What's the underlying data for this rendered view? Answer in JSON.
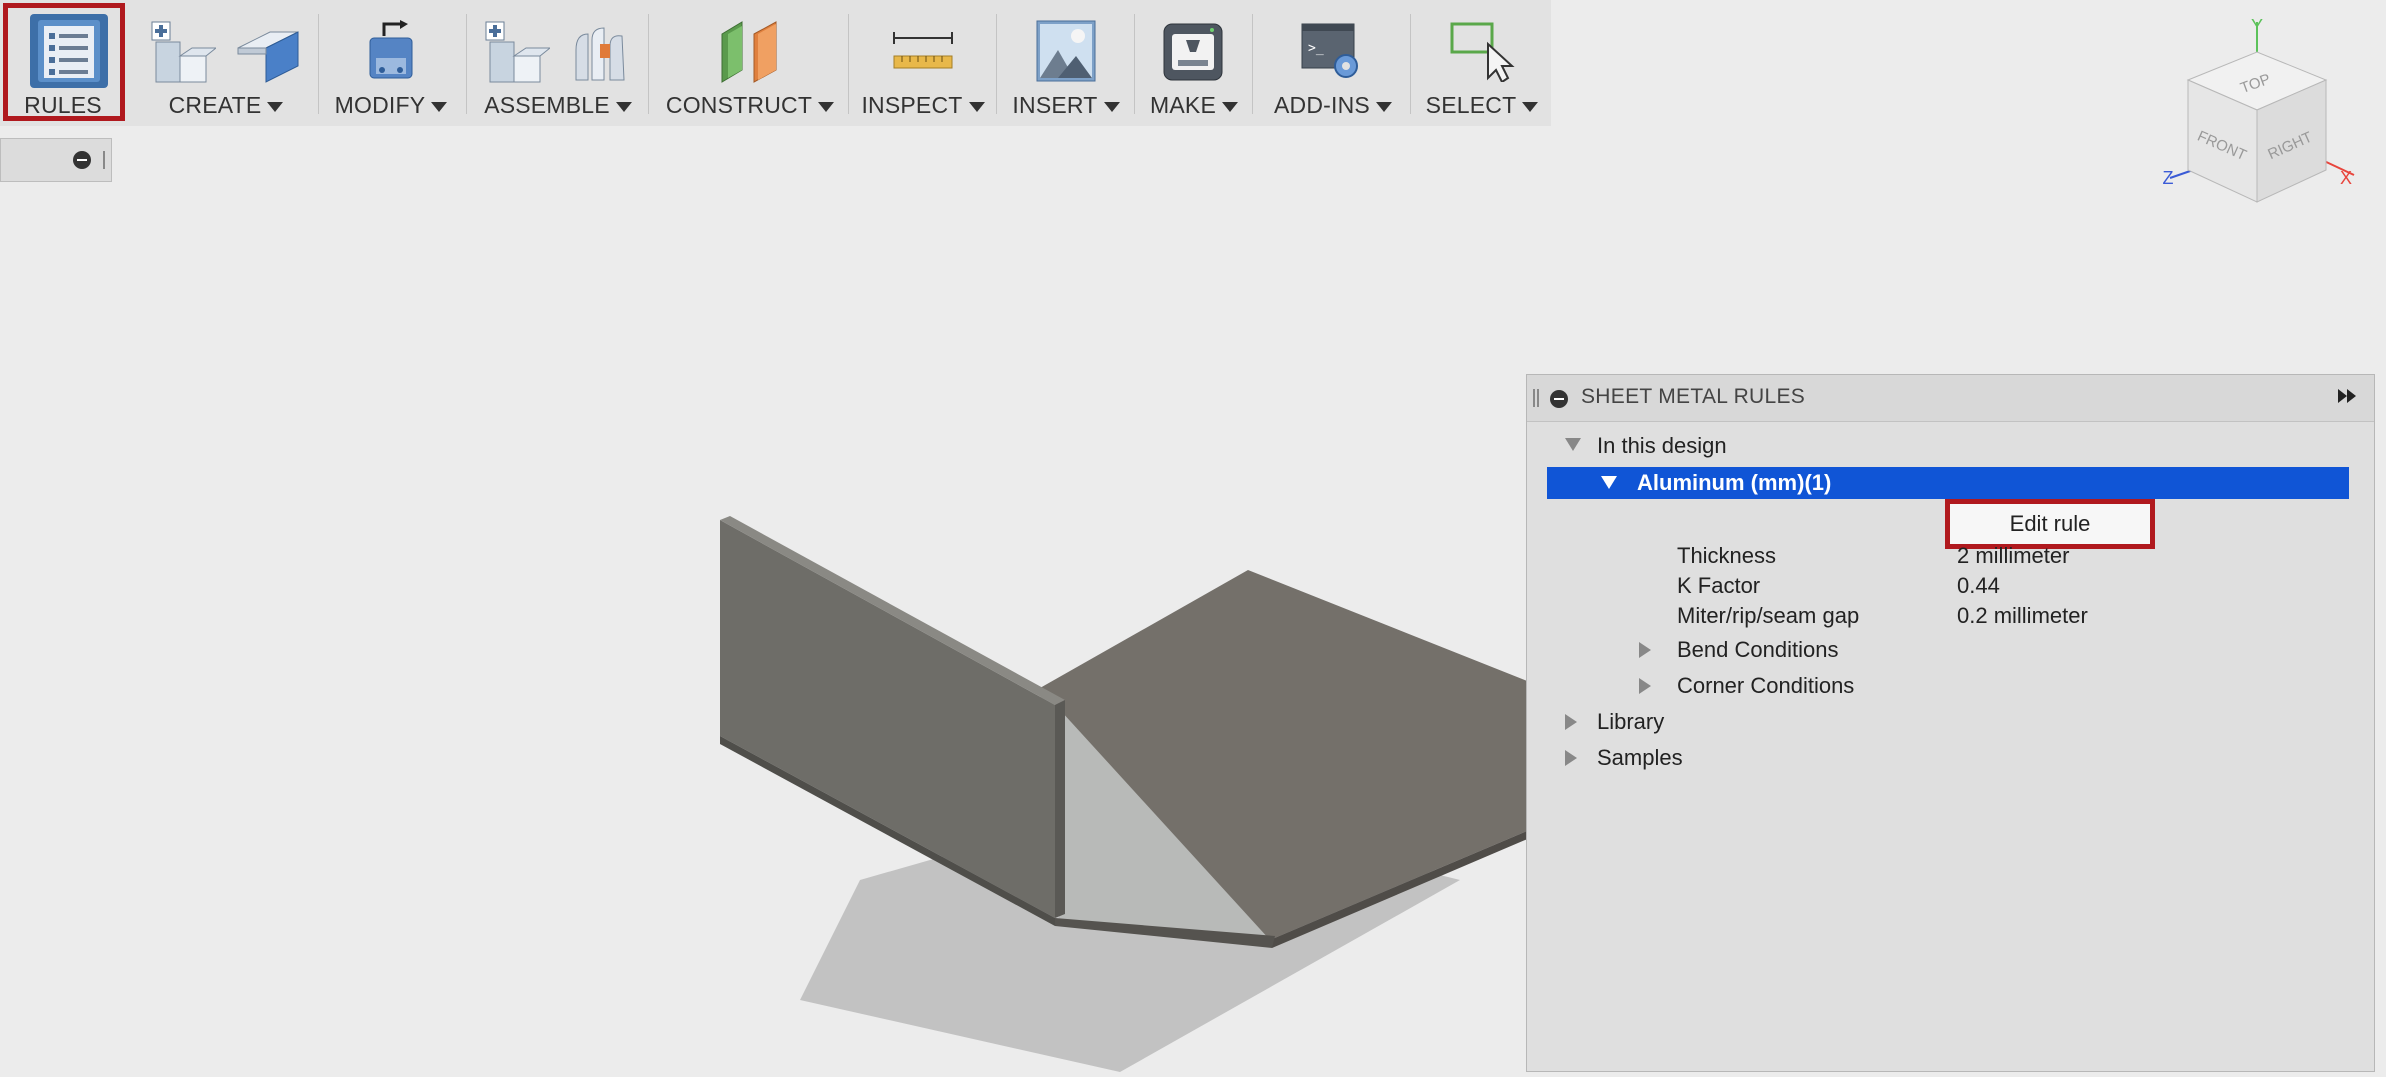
{
  "toolbar": {
    "rules": "RULES",
    "create": "CREATE",
    "modify": "MODIFY",
    "assemble": "ASSEMBLE",
    "construct": "CONSTRUCT",
    "inspect": "INSPECT",
    "insert": "INSERT",
    "make": "MAKE",
    "addins": "ADD-INS",
    "select": "SELECT"
  },
  "viewcube": {
    "top": "TOP",
    "front": "FRONT",
    "right": "RIGHT",
    "axis_x": "X",
    "axis_y": "Y",
    "axis_z": "Z"
  },
  "panel": {
    "title": "SHEET METAL RULES",
    "in_design": "In this design",
    "rule_name": "Aluminum (mm)(1)",
    "edit_rule": "Edit rule",
    "props": [
      {
        "name": "Thickness",
        "value": "2 millimeter"
      },
      {
        "name": "K Factor",
        "value": "0.44"
      },
      {
        "name": "Miter/rip/seam gap",
        "value": "0.2 millimeter"
      }
    ],
    "bend_conditions": "Bend Conditions",
    "corner_conditions": "Corner Conditions",
    "library": "Library",
    "samples": "Samples"
  },
  "colors": {
    "selection": "#1055d6",
    "highlight": "#b0191e",
    "axis_x": "#e8453c",
    "axis_y": "#5cc25a",
    "axis_z": "#3b5bd6"
  }
}
